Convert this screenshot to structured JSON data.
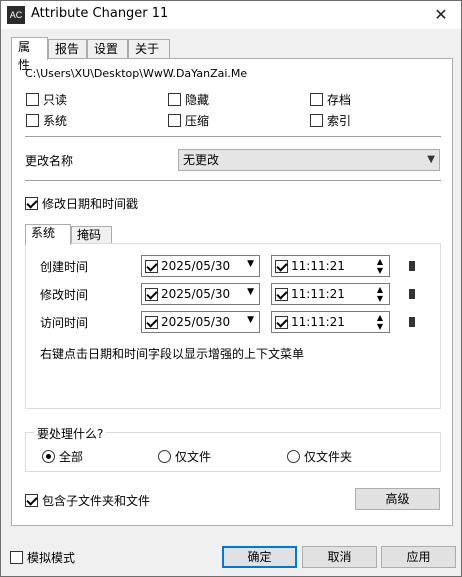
{
  "window": {
    "title": "Attribute Changer 11",
    "icon_text": "AC",
    "close_glyph": "✕"
  },
  "tabs": [
    {
      "label": "属性"
    },
    {
      "label": "报告"
    },
    {
      "label": "设置"
    },
    {
      "label": "关于"
    }
  ],
  "attributes": {
    "path": "C:\\Users\\XU\\Desktop\\WwW.DaYanZai.Me",
    "checkboxes": [
      {
        "label": "只读"
      },
      {
        "label": "隐藏"
      },
      {
        "label": "存档"
      },
      {
        "label": "系统"
      },
      {
        "label": "压缩"
      },
      {
        "label": "索引"
      }
    ]
  },
  "rename": {
    "label": "更改名称",
    "value": "无更改"
  },
  "datetime": {
    "label": "修改日期和时间戳",
    "checked": true,
    "inner_tabs": [
      {
        "label": "系统"
      },
      {
        "label": "掩码"
      }
    ],
    "rows": [
      {
        "label": "创建时间",
        "date": "2025/05/30",
        "time": "11:11:21"
      },
      {
        "label": "修改时间",
        "date": "2025/05/30",
        "time": "11:11:21"
      },
      {
        "label": "访问时间",
        "date": "2025/05/30",
        "time": "11:11:21"
      }
    ],
    "hint": "右键点击日期和时间字段以显示增强的上下文菜单"
  },
  "process": {
    "label": "要处理什么?",
    "options": [
      {
        "label": "全部",
        "checked": true
      },
      {
        "label": "仅文件",
        "checked": false
      },
      {
        "label": "仅文件夹",
        "checked": false
      }
    ]
  },
  "subfolders": {
    "label": "包含子文件夹和文件",
    "checked": true
  },
  "advanced_label": "高级",
  "footer": {
    "simulate_label": "模拟模式",
    "ok_label": "确定",
    "cancel_label": "取消",
    "apply_label": "应用"
  },
  "colors": {
    "accent": "#0078d7",
    "panel": "#ffffff",
    "chrome": "#f0f0f0"
  }
}
